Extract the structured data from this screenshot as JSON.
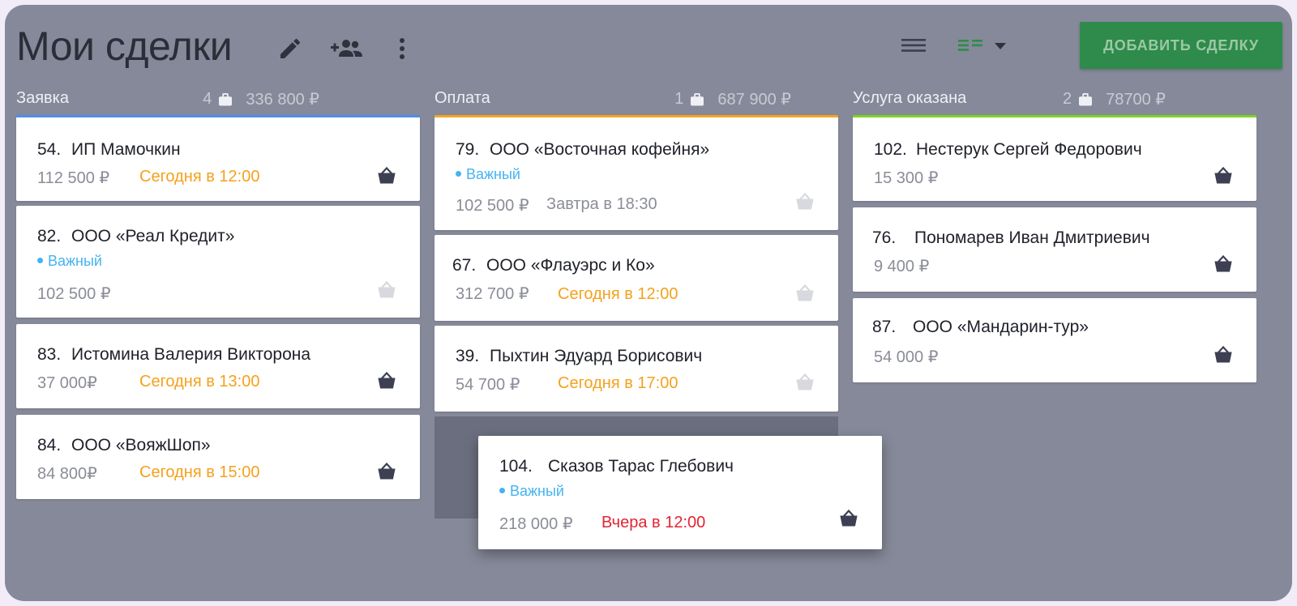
{
  "header": {
    "title": "Мои сделки",
    "add_button": "ДОБАВИТЬ СДЕЛКУ",
    "icons": [
      "edit-icon",
      "add-people-icon",
      "more-vert-icon",
      "list-view-icon",
      "board-view-icon",
      "dropdown-caret-icon"
    ]
  },
  "columns": [
    {
      "name": "Заявка",
      "count": "4",
      "total": "336 800 ₽",
      "accent": "#4f8fe8",
      "cards": [
        {
          "num": "54.",
          "title": "ИП Мамочкин",
          "amount": "112 500 ₽",
          "due": "Сегодня в 12:00",
          "due_color": "#f5a11b",
          "basket": "dark"
        },
        {
          "num": "82.",
          "title": "ООО «Реал Кредит»",
          "badge": "Важный",
          "amount": "102 500 ₽",
          "due": "",
          "basket": "light"
        },
        {
          "num": "83.",
          "title": "Истомина Валерия Викторона",
          "amount": "37 000₽",
          "due": "Сегодня в 13:00",
          "due_color": "#f5a11b",
          "basket": "dark"
        },
        {
          "num": "84.",
          "title": "ООО «ВояжШоп»",
          "amount": "84 800₽",
          "due": "Сегодня в 15:00",
          "due_color": "#f5a11b",
          "basket": "dark"
        }
      ]
    },
    {
      "name": "Оплата",
      "count": "1",
      "total": "687 900 ₽",
      "accent": "#f5a623",
      "cards": [
        {
          "num": "79.",
          "title": "ООО «Восточная кофейня»",
          "badge": "Важный",
          "amount": "102 500 ₽",
          "due": "Завтра в 18:30",
          "due_color": "#8a8d97",
          "basket": "light"
        },
        {
          "num": "67.",
          "title": "ООО «Флауэрс и Ко»",
          "amount": "312 700 ₽",
          "due": "Сегодня в 12:00",
          "due_color": "#f5a11b",
          "basket": "light"
        },
        {
          "num": "39.",
          "title": "Пыхтин Эдуард Борисович",
          "amount": "54 700 ₽",
          "due": "Сегодня в 17:00",
          "due_color": "#f5a11b",
          "basket": "light"
        }
      ]
    },
    {
      "name": "Услуга оказана",
      "count": "2",
      "total": "78700 ₽",
      "accent": "#7ed321",
      "cards": [
        {
          "num": "102.",
          "title": "Нестерук Сергей Федорович",
          "amount": "15 300 ₽",
          "due": "",
          "basket": "dark"
        },
        {
          "num": "76.",
          "title": "Пономарев Иван Дмитриевич",
          "amount": "9 400 ₽",
          "due": "",
          "basket": "dark"
        },
        {
          "num": "87.",
          "title": "ООО «Мандарин-тур»",
          "amount": "54 000 ₽",
          "due": "",
          "basket": "dark"
        }
      ]
    }
  ],
  "dragged_card": {
    "num": "104.",
    "title": "Сказов Тарас Глебович",
    "badge": "Важный",
    "amount": "218 000 ₽",
    "due": "Вчера в 12:00",
    "due_color": "#e22434",
    "basket": "dark"
  }
}
